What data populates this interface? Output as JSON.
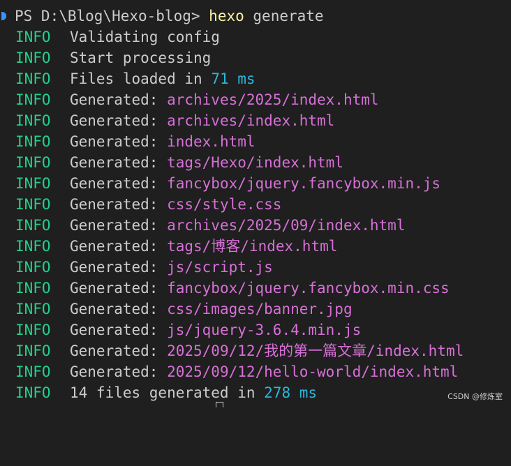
{
  "terminal": {
    "prompt": {
      "ps": "PS D:\\Blog\\Hexo-blog>",
      "command": "hexo",
      "argument": "generate"
    },
    "lines": [
      {
        "level": "INFO",
        "text": "Validating config"
      },
      {
        "level": "INFO",
        "text": "Start processing"
      },
      {
        "level": "INFO",
        "text": "Files loaded in",
        "number": "71",
        "unit": "ms"
      },
      {
        "level": "INFO",
        "text": "Generated:",
        "path": "archives/2025/index.html"
      },
      {
        "level": "INFO",
        "text": "Generated:",
        "path": "archives/index.html"
      },
      {
        "level": "INFO",
        "text": "Generated:",
        "path": "index.html"
      },
      {
        "level": "INFO",
        "text": "Generated:",
        "path": "tags/Hexo/index.html"
      },
      {
        "level": "INFO",
        "text": "Generated:",
        "path": "fancybox/jquery.fancybox.min.js"
      },
      {
        "level": "INFO",
        "text": "Generated:",
        "path": "css/style.css"
      },
      {
        "level": "INFO",
        "text": "Generated:",
        "path": "archives/2025/09/index.html"
      },
      {
        "level": "INFO",
        "text": "Generated:",
        "path": "tags/博客/index.html"
      },
      {
        "level": "INFO",
        "text": "Generated:",
        "path": "js/script.js"
      },
      {
        "level": "INFO",
        "text": "Generated:",
        "path": "fancybox/jquery.fancybox.min.css"
      },
      {
        "level": "INFO",
        "text": "Generated:",
        "path": "css/images/banner.jpg"
      },
      {
        "level": "INFO",
        "text": "Generated:",
        "path": "js/jquery-3.6.4.min.js"
      },
      {
        "level": "INFO",
        "text": "Generated:",
        "path": "2025/09/12/我的第一篇文章/index.html"
      },
      {
        "level": "INFO",
        "text": "Generated:",
        "path": "2025/09/12/hello-world/index.html"
      },
      {
        "level": "INFO",
        "text": "14 files generated in",
        "number": "278",
        "unit": "ms"
      }
    ]
  },
  "watermark": "CSDN @修炼室",
  "colors": {
    "background": "#1f1f1f",
    "text": "#cccccc",
    "info": "#23d18b",
    "command": "#f9f1a5",
    "path": "#d670d6",
    "number": "#29b8db",
    "gutter_marker": "#3794ff"
  }
}
